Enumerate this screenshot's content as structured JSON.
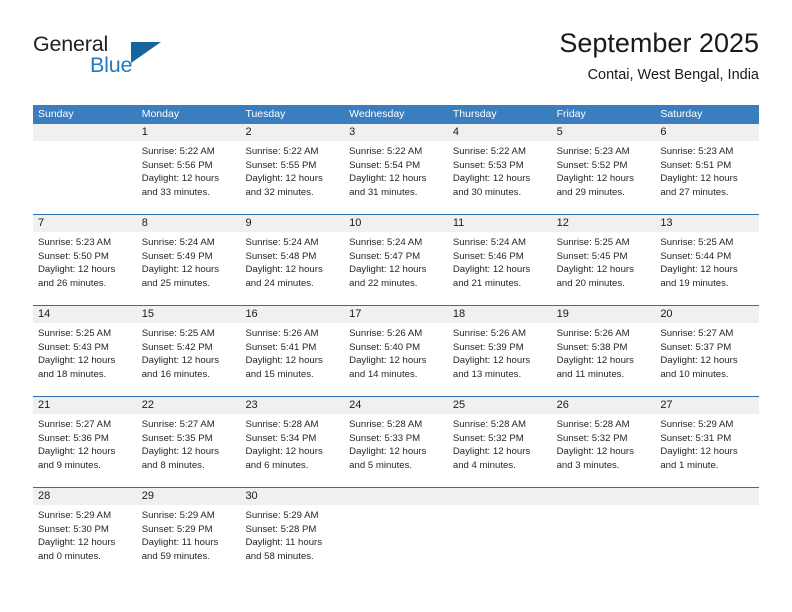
{
  "brand": {
    "word_one": "General",
    "word_two": "Blue",
    "triangle_icon": "triangle-icon",
    "accent_color": "#1f7ac4"
  },
  "header": {
    "title": "September 2025",
    "location": "Contai, West Bengal, India"
  },
  "theme": {
    "header_blue": "#3b7ebf",
    "rule_blue": "#2f6fad",
    "daynum_band": "#f0f0f0"
  },
  "weekday_headers": [
    "Sunday",
    "Monday",
    "Tuesday",
    "Wednesday",
    "Thursday",
    "Friday",
    "Saturday"
  ],
  "weeks": [
    [
      {
        "day": "",
        "sunrise": "",
        "sunset": "",
        "daylight_1": "",
        "daylight_2": "",
        "empty": true
      },
      {
        "day": "1",
        "sunrise": "Sunrise: 5:22 AM",
        "sunset": "Sunset: 5:56 PM",
        "daylight_1": "Daylight: 12 hours",
        "daylight_2": "and 33 minutes."
      },
      {
        "day": "2",
        "sunrise": "Sunrise: 5:22 AM",
        "sunset": "Sunset: 5:55 PM",
        "daylight_1": "Daylight: 12 hours",
        "daylight_2": "and 32 minutes."
      },
      {
        "day": "3",
        "sunrise": "Sunrise: 5:22 AM",
        "sunset": "Sunset: 5:54 PM",
        "daylight_1": "Daylight: 12 hours",
        "daylight_2": "and 31 minutes."
      },
      {
        "day": "4",
        "sunrise": "Sunrise: 5:22 AM",
        "sunset": "Sunset: 5:53 PM",
        "daylight_1": "Daylight: 12 hours",
        "daylight_2": "and 30 minutes."
      },
      {
        "day": "5",
        "sunrise": "Sunrise: 5:23 AM",
        "sunset": "Sunset: 5:52 PM",
        "daylight_1": "Daylight: 12 hours",
        "daylight_2": "and 29 minutes."
      },
      {
        "day": "6",
        "sunrise": "Sunrise: 5:23 AM",
        "sunset": "Sunset: 5:51 PM",
        "daylight_1": "Daylight: 12 hours",
        "daylight_2": "and 27 minutes."
      }
    ],
    [
      {
        "day": "7",
        "sunrise": "Sunrise: 5:23 AM",
        "sunset": "Sunset: 5:50 PM",
        "daylight_1": "Daylight: 12 hours",
        "daylight_2": "and 26 minutes."
      },
      {
        "day": "8",
        "sunrise": "Sunrise: 5:24 AM",
        "sunset": "Sunset: 5:49 PM",
        "daylight_1": "Daylight: 12 hours",
        "daylight_2": "and 25 minutes."
      },
      {
        "day": "9",
        "sunrise": "Sunrise: 5:24 AM",
        "sunset": "Sunset: 5:48 PM",
        "daylight_1": "Daylight: 12 hours",
        "daylight_2": "and 24 minutes."
      },
      {
        "day": "10",
        "sunrise": "Sunrise: 5:24 AM",
        "sunset": "Sunset: 5:47 PM",
        "daylight_1": "Daylight: 12 hours",
        "daylight_2": "and 22 minutes."
      },
      {
        "day": "11",
        "sunrise": "Sunrise: 5:24 AM",
        "sunset": "Sunset: 5:46 PM",
        "daylight_1": "Daylight: 12 hours",
        "daylight_2": "and 21 minutes."
      },
      {
        "day": "12",
        "sunrise": "Sunrise: 5:25 AM",
        "sunset": "Sunset: 5:45 PM",
        "daylight_1": "Daylight: 12 hours",
        "daylight_2": "and 20 minutes."
      },
      {
        "day": "13",
        "sunrise": "Sunrise: 5:25 AM",
        "sunset": "Sunset: 5:44 PM",
        "daylight_1": "Daylight: 12 hours",
        "daylight_2": "and 19 minutes."
      }
    ],
    [
      {
        "day": "14",
        "sunrise": "Sunrise: 5:25 AM",
        "sunset": "Sunset: 5:43 PM",
        "daylight_1": "Daylight: 12 hours",
        "daylight_2": "and 18 minutes."
      },
      {
        "day": "15",
        "sunrise": "Sunrise: 5:25 AM",
        "sunset": "Sunset: 5:42 PM",
        "daylight_1": "Daylight: 12 hours",
        "daylight_2": "and 16 minutes."
      },
      {
        "day": "16",
        "sunrise": "Sunrise: 5:26 AM",
        "sunset": "Sunset: 5:41 PM",
        "daylight_1": "Daylight: 12 hours",
        "daylight_2": "and 15 minutes."
      },
      {
        "day": "17",
        "sunrise": "Sunrise: 5:26 AM",
        "sunset": "Sunset: 5:40 PM",
        "daylight_1": "Daylight: 12 hours",
        "daylight_2": "and 14 minutes."
      },
      {
        "day": "18",
        "sunrise": "Sunrise: 5:26 AM",
        "sunset": "Sunset: 5:39 PM",
        "daylight_1": "Daylight: 12 hours",
        "daylight_2": "and 13 minutes."
      },
      {
        "day": "19",
        "sunrise": "Sunrise: 5:26 AM",
        "sunset": "Sunset: 5:38 PM",
        "daylight_1": "Daylight: 12 hours",
        "daylight_2": "and 11 minutes."
      },
      {
        "day": "20",
        "sunrise": "Sunrise: 5:27 AM",
        "sunset": "Sunset: 5:37 PM",
        "daylight_1": "Daylight: 12 hours",
        "daylight_2": "and 10 minutes."
      }
    ],
    [
      {
        "day": "21",
        "sunrise": "Sunrise: 5:27 AM",
        "sunset": "Sunset: 5:36 PM",
        "daylight_1": "Daylight: 12 hours",
        "daylight_2": "and 9 minutes."
      },
      {
        "day": "22",
        "sunrise": "Sunrise: 5:27 AM",
        "sunset": "Sunset: 5:35 PM",
        "daylight_1": "Daylight: 12 hours",
        "daylight_2": "and 8 minutes."
      },
      {
        "day": "23",
        "sunrise": "Sunrise: 5:28 AM",
        "sunset": "Sunset: 5:34 PM",
        "daylight_1": "Daylight: 12 hours",
        "daylight_2": "and 6 minutes."
      },
      {
        "day": "24",
        "sunrise": "Sunrise: 5:28 AM",
        "sunset": "Sunset: 5:33 PM",
        "daylight_1": "Daylight: 12 hours",
        "daylight_2": "and 5 minutes."
      },
      {
        "day": "25",
        "sunrise": "Sunrise: 5:28 AM",
        "sunset": "Sunset: 5:32 PM",
        "daylight_1": "Daylight: 12 hours",
        "daylight_2": "and 4 minutes."
      },
      {
        "day": "26",
        "sunrise": "Sunrise: 5:28 AM",
        "sunset": "Sunset: 5:32 PM",
        "daylight_1": "Daylight: 12 hours",
        "daylight_2": "and 3 minutes."
      },
      {
        "day": "27",
        "sunrise": "Sunrise: 5:29 AM",
        "sunset": "Sunset: 5:31 PM",
        "daylight_1": "Daylight: 12 hours",
        "daylight_2": "and 1 minute."
      }
    ],
    [
      {
        "day": "28",
        "sunrise": "Sunrise: 5:29 AM",
        "sunset": "Sunset: 5:30 PM",
        "daylight_1": "Daylight: 12 hours",
        "daylight_2": "and 0 minutes."
      },
      {
        "day": "29",
        "sunrise": "Sunrise: 5:29 AM",
        "sunset": "Sunset: 5:29 PM",
        "daylight_1": "Daylight: 11 hours",
        "daylight_2": "and 59 minutes."
      },
      {
        "day": "30",
        "sunrise": "Sunrise: 5:29 AM",
        "sunset": "Sunset: 5:28 PM",
        "daylight_1": "Daylight: 11 hours",
        "daylight_2": "and 58 minutes."
      },
      {
        "day": "",
        "sunrise": "",
        "sunset": "",
        "daylight_1": "",
        "daylight_2": "",
        "empty": true
      },
      {
        "day": "",
        "sunrise": "",
        "sunset": "",
        "daylight_1": "",
        "daylight_2": "",
        "empty": true
      },
      {
        "day": "",
        "sunrise": "",
        "sunset": "",
        "daylight_1": "",
        "daylight_2": "",
        "empty": true
      },
      {
        "day": "",
        "sunrise": "",
        "sunset": "",
        "daylight_1": "",
        "daylight_2": "",
        "empty": true
      }
    ]
  ]
}
